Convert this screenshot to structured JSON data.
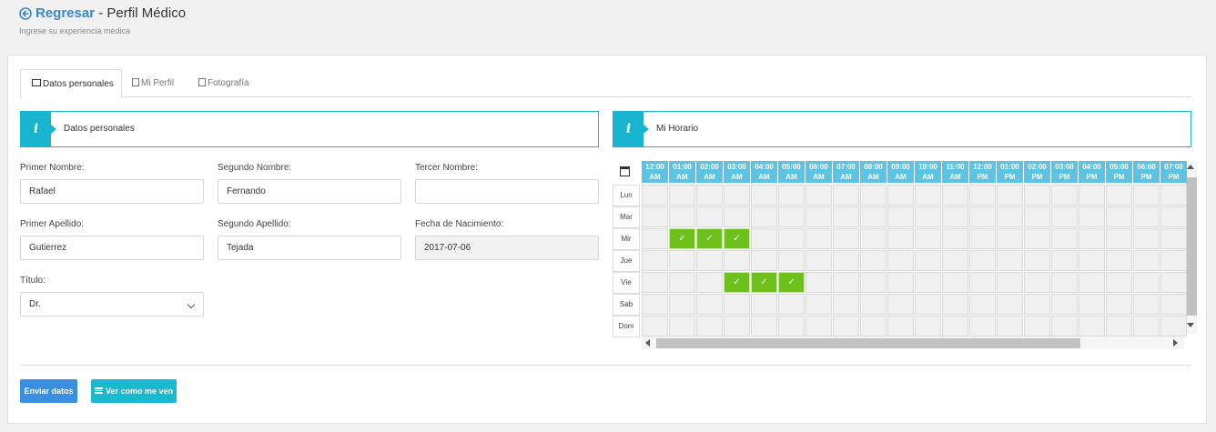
{
  "header": {
    "back_label": "Regresar",
    "title": " - Perfil Médico",
    "subtitle": "Ingrese su experiencia médica"
  },
  "tabs": [
    {
      "label": "Datos personales",
      "icon": "id-card-icon",
      "active": true
    },
    {
      "label": "Mi Perfil",
      "icon": "user-card-icon",
      "active": false
    },
    {
      "label": "Fotografía",
      "icon": "image-icon",
      "active": false
    }
  ],
  "personal_section": {
    "title": "Datos personales",
    "fields": {
      "primer_nombre": {
        "label": "Primer Nombre:",
        "value": "Rafael"
      },
      "segundo_nombre": {
        "label": "Segundo Nombre:",
        "value": "Fernando"
      },
      "tercer_nombre": {
        "label": "Tercer Nombre:",
        "value": ""
      },
      "primer_apellido": {
        "label": "Primer Apellido:",
        "value": "Gutierrez"
      },
      "segundo_apellido": {
        "label": "Segundo Apellido:",
        "value": "Tejada"
      },
      "fecha_nacimiento": {
        "label": "Fecha de Nacimiento:",
        "value": "2017-07-06"
      },
      "titulo": {
        "label": "Título:",
        "value": "Dr."
      }
    }
  },
  "schedule_section": {
    "title": "Mi Horario",
    "hours": [
      {
        "time": "12:00",
        "period": "AM"
      },
      {
        "time": "01:00",
        "period": "AM"
      },
      {
        "time": "02:00",
        "period": "AM"
      },
      {
        "time": "03:00",
        "period": "AM"
      },
      {
        "time": "04:00",
        "period": "AM"
      },
      {
        "time": "05:00",
        "period": "AM"
      },
      {
        "time": "06:00",
        "period": "AM"
      },
      {
        "time": "07:00",
        "period": "AM"
      },
      {
        "time": "08:00",
        "period": "AM"
      },
      {
        "time": "09:00",
        "period": "AM"
      },
      {
        "time": "10:00",
        "period": "AM"
      },
      {
        "time": "11:00",
        "period": "AM"
      },
      {
        "time": "12:00",
        "period": "PM"
      },
      {
        "time": "01:00",
        "period": "PM"
      },
      {
        "time": "02:00",
        "period": "PM"
      },
      {
        "time": "03:00",
        "period": "PM"
      },
      {
        "time": "04:00",
        "period": "PM"
      },
      {
        "time": "05:00",
        "period": "PM"
      },
      {
        "time": "06:00",
        "period": "PM"
      },
      {
        "time": "07:00",
        "period": "PM"
      }
    ],
    "days": [
      "Lun",
      "Mar",
      "Mir",
      "Jue",
      "Vie",
      "Sab",
      "Dom"
    ],
    "selected": {
      "Mir": [
        1,
        2,
        3
      ],
      "Vie": [
        3,
        4,
        5
      ]
    },
    "check_symbol": "✓",
    "selected_color": "#6ec01c"
  },
  "actions": {
    "submit_label": "Enviar datos",
    "view_label": "Ver como me ven"
  },
  "colors": {
    "accent": "#19b5d0",
    "primary": "#3b8fe0",
    "link": "#3a87c8"
  }
}
